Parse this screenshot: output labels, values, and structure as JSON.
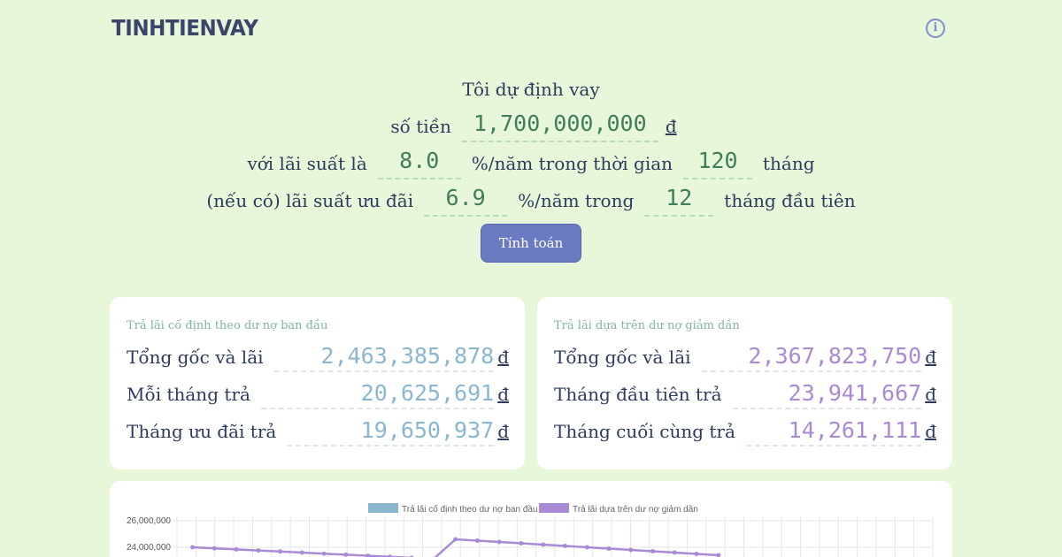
{
  "logo": "TINHTIENVAY",
  "info_icon": "info-icon",
  "form": {
    "line1": "Tôi dự định vay",
    "amount_label": "số tiền",
    "amount_value": "1,700,000,000",
    "currency": "đ",
    "rate_prefix": "với lãi suất là",
    "rate_value": "8.0",
    "rate_mid": "%/năm trong thời gian",
    "term_value": "120",
    "term_unit": "tháng",
    "promo_prefix": "(nếu có) lãi suất ưu đãi",
    "promo_rate_value": "6.9",
    "promo_mid": "%/năm trong",
    "promo_months_value": "12",
    "promo_suffix": "tháng đầu tiên"
  },
  "calculate_button": "Tính toán",
  "fixed_card": {
    "title": "Trả lãi cố định theo dư nợ ban đầu",
    "rows": [
      {
        "label": "Tổng gốc và lãi",
        "value": "2,463,385,878",
        "unit": "đ"
      },
      {
        "label": "Mỗi tháng trả",
        "value": "20,625,691",
        "unit": "đ"
      },
      {
        "label": "Tháng ưu đãi trả",
        "value": "19,650,937",
        "unit": "đ"
      }
    ]
  },
  "declining_card": {
    "title": "Trả lãi dựa trên dư nợ giảm dần",
    "rows": [
      {
        "label": "Tổng gốc và lãi",
        "value": "2,367,823,750",
        "unit": "đ"
      },
      {
        "label": "Tháng đầu tiên trả",
        "value": "23,941,667",
        "unit": "đ"
      },
      {
        "label": "Tháng cuối cùng trả",
        "value": "14,261,111",
        "unit": "đ"
      }
    ]
  },
  "colors": {
    "fixed": "#8ab7cf",
    "declining": "#a98ad4"
  },
  "chart_data": {
    "type": "line",
    "title": "",
    "xlabel": "",
    "ylabel": "",
    "y_ticks": [
      "26,000,000",
      "24,000,000"
    ],
    "ylim": [
      14000000,
      26000000
    ],
    "legend_position": "top",
    "grid": true,
    "series": [
      {
        "name": "Trả lãi cố định theo dư nợ ban đầu",
        "color": "#8ab7cf",
        "values": []
      },
      {
        "name": "Trả lãi dựa trên dư nợ giảm dần",
        "color": "#a98ad4",
        "x": [
          1,
          2,
          3,
          4,
          5,
          6,
          7,
          8,
          9,
          10,
          11,
          12,
          13,
          14,
          15,
          16,
          17,
          18,
          19,
          20,
          21,
          22,
          23,
          24,
          25
        ],
        "values": [
          24000000,
          23920000,
          23840000,
          23760000,
          23680000,
          23600000,
          23520000,
          23440000,
          23360000,
          23280000,
          23200000,
          23120000,
          24600000,
          24500000,
          24400000,
          24300000,
          24200000,
          24100000,
          24000000,
          23900000,
          23800000,
          23700000,
          23600000,
          23500000,
          23400000
        ]
      }
    ]
  }
}
